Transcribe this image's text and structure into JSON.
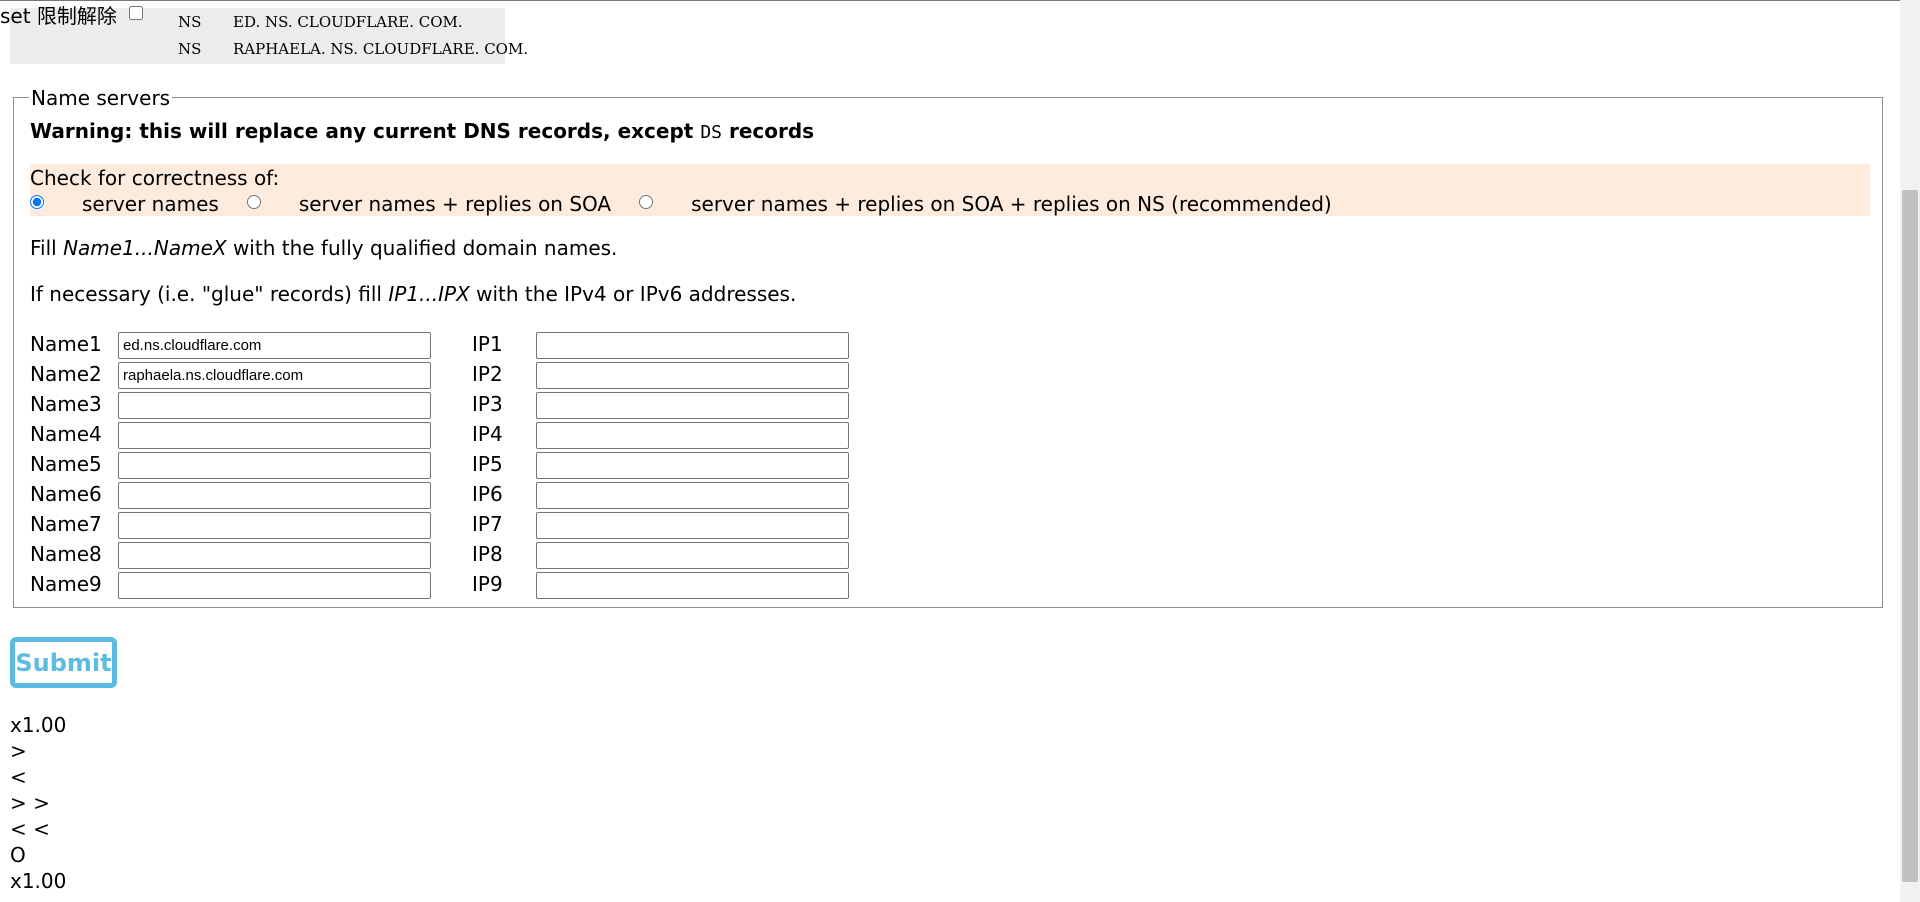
{
  "header": {
    "set_label": "set 限制解除",
    "set_checked": false
  },
  "ns_records": [
    {
      "type": "NS",
      "value": "ED. NS. CLOUDFLARE. COM."
    },
    {
      "type": "NS",
      "value": "RAPHAELA. NS. CLOUDFLARE. COM."
    }
  ],
  "form": {
    "legend": "Name servers",
    "warning_prefix": "Warning: this will replace any current DNS records, except ",
    "warning_code": "DS",
    "warning_suffix": " records",
    "check_title": "Check for correctness of:",
    "check_options": [
      {
        "label": "server names",
        "checked": true
      },
      {
        "label": "server names + replies on SOA",
        "checked": false
      },
      {
        "label": "server names + replies on SOA + replies on NS (recommended)",
        "checked": false
      }
    ],
    "fill_names": {
      "before": "Fill ",
      "italic": "Name1...NameX",
      "after": " with the fully qualified domain names."
    },
    "fill_ips": {
      "before": "If necessary (i.e. \"glue\" records) fill ",
      "italic": "IP1...IPX",
      "after": " with the IPv4 or IPv6 addresses."
    },
    "rows": [
      {
        "name_label": "Name1",
        "name_value": "ed.ns.cloudflare.com",
        "ip_label": "IP1",
        "ip_value": ""
      },
      {
        "name_label": "Name2",
        "name_value": "raphaela.ns.cloudflare.com",
        "ip_label": "IP2",
        "ip_value": ""
      },
      {
        "name_label": "Name3",
        "name_value": "",
        "ip_label": "IP3",
        "ip_value": ""
      },
      {
        "name_label": "Name4",
        "name_value": "",
        "ip_label": "IP4",
        "ip_value": ""
      },
      {
        "name_label": "Name5",
        "name_value": "",
        "ip_label": "IP5",
        "ip_value": ""
      },
      {
        "name_label": "Name6",
        "name_value": "",
        "ip_label": "IP6",
        "ip_value": ""
      },
      {
        "name_label": "Name7",
        "name_value": "",
        "ip_label": "IP7",
        "ip_value": ""
      },
      {
        "name_label": "Name8",
        "name_value": "",
        "ip_label": "IP8",
        "ip_value": ""
      },
      {
        "name_label": "Name9",
        "name_value": "",
        "ip_label": "IP9",
        "ip_value": ""
      }
    ],
    "submit_label": "Submit"
  },
  "controls": [
    "x1.00",
    ">",
    "<",
    "> >",
    "< <",
    "O",
    "x1.00"
  ],
  "colors": {
    "check_bg": "#fdebdd",
    "ns_bg": "#ececec",
    "submit_accent": "#5bbbe0"
  }
}
